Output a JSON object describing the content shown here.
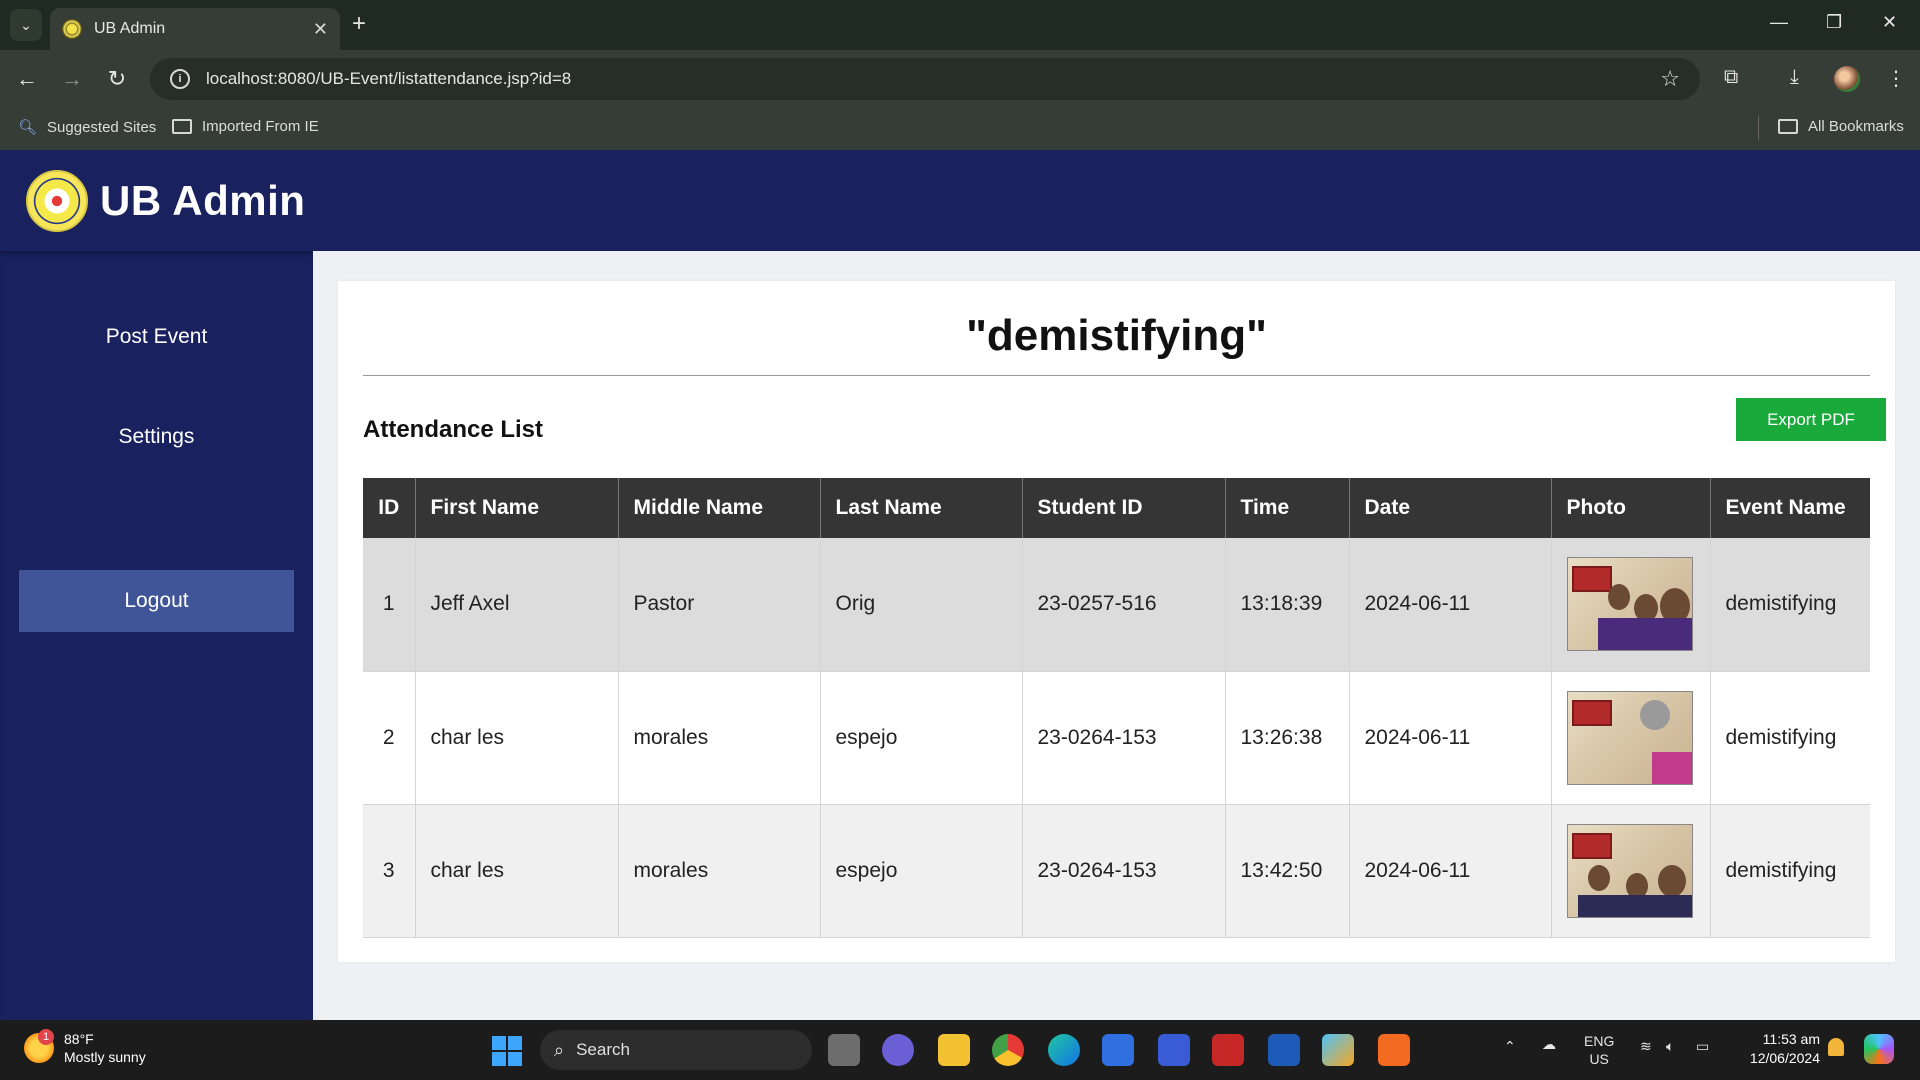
{
  "browser": {
    "tab_title": "UB Admin",
    "url": "localhost:8080/UB-Event/listattendance.jsp?id=8",
    "bookmarks": [
      "Suggested Sites",
      "Imported From IE"
    ],
    "all_bookmarks_label": "All Bookmarks"
  },
  "app": {
    "brand": "UB Admin",
    "sidebar": {
      "post_event": "Post Event",
      "settings": "Settings",
      "logout": "Logout"
    }
  },
  "page": {
    "event_title": "\"demistifying\"",
    "section_title": "Attendance List",
    "export_label": "Export PDF",
    "columns": [
      "ID",
      "First Name",
      "Middle Name",
      "Last Name",
      "Student ID",
      "Time",
      "Date",
      "Photo",
      "Event Name"
    ],
    "rows": [
      {
        "id": "1",
        "first": "Jeff Axel",
        "middle": "Pastor",
        "last": "Orig",
        "student_id": "23-0257-516",
        "time": "13:18:39",
        "date": "2024-06-11",
        "event": "demistifying"
      },
      {
        "id": "2",
        "first": "char les",
        "middle": "morales",
        "last": "espejo",
        "student_id": "23-0264-153",
        "time": "13:26:38",
        "date": "2024-06-11",
        "event": "demistifying"
      },
      {
        "id": "3",
        "first": "char les",
        "middle": "morales",
        "last": "espejo",
        "student_id": "23-0264-153",
        "time": "13:42:50",
        "date": "2024-06-11",
        "event": "demistifying"
      }
    ]
  },
  "taskbar": {
    "temperature": "88°F",
    "weather": "Mostly sunny",
    "weather_badge": "1",
    "search_label": "Search",
    "lang": "ENG",
    "region": "US",
    "time": "11:53 am",
    "date": "12/06/2024"
  }
}
